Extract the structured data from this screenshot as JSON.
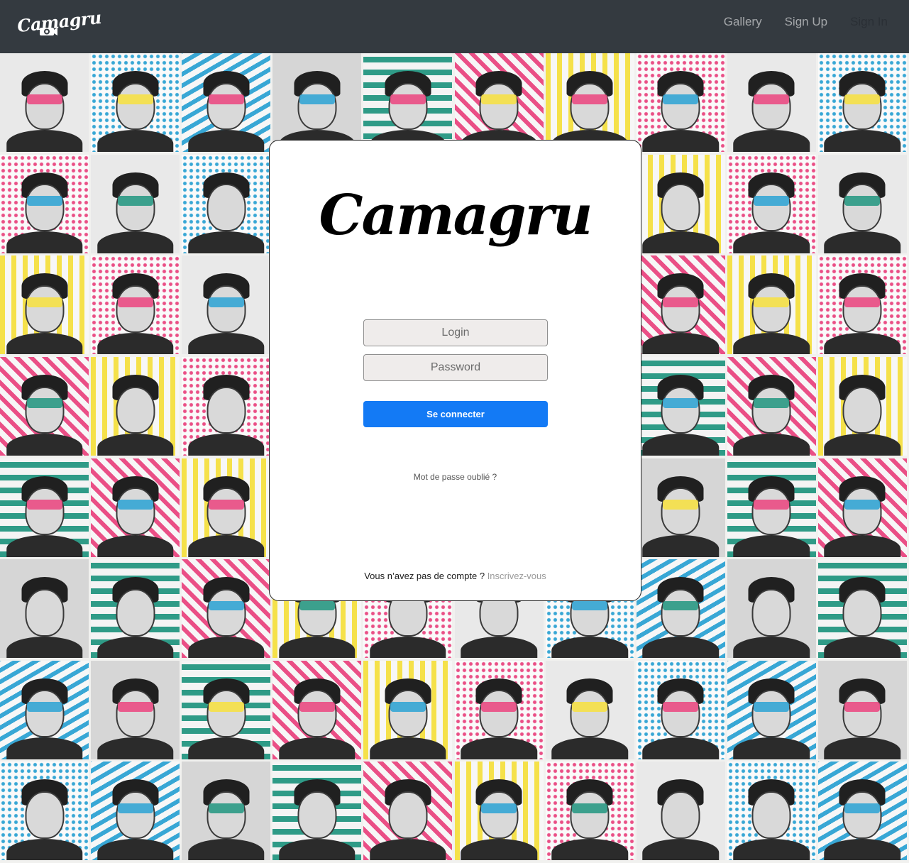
{
  "navbar": {
    "brand": "Camagru",
    "links": [
      {
        "label": "Gallery"
      },
      {
        "label": "Sign Up"
      },
      {
        "label": "Sign In"
      }
    ]
  },
  "modal": {
    "logo": "Camagru",
    "login_placeholder": "Login",
    "password_placeholder": "Password",
    "submit_label": "Se connecter",
    "forgot_label": "Mot de passe oublié ?",
    "signup_prompt": "Vous n’avez pas de compte ?",
    "signup_link": "Inscrivez-vous"
  },
  "colors": {
    "navbar_bg": "#343a40",
    "primary": "#137af5",
    "collage_pink": "#ea4f86",
    "collage_cyan": "#38a7d5",
    "collage_yellow": "#f5e14a",
    "collage_teal": "#2f9b87"
  }
}
